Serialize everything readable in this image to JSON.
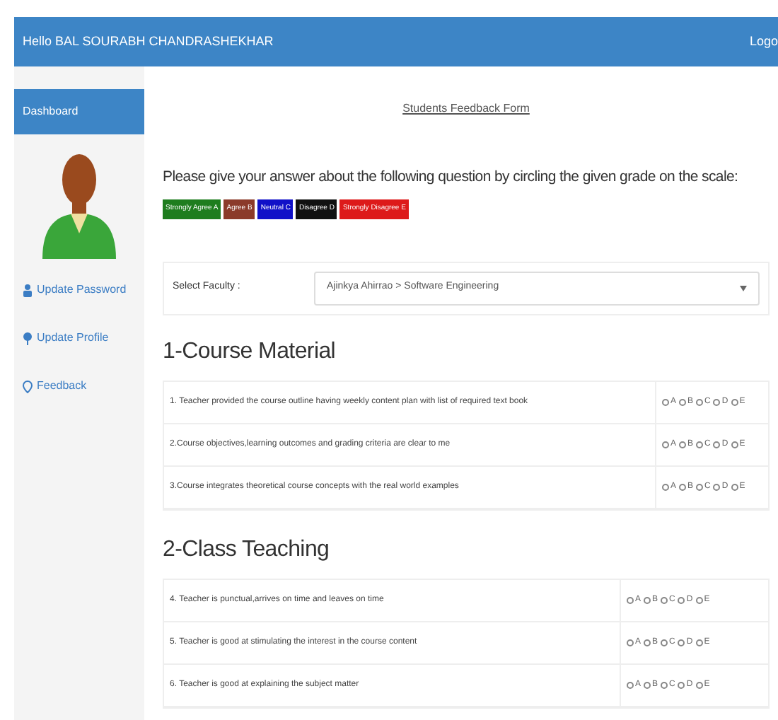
{
  "navbar": {
    "greeting": "Hello BAL SOURABH CHANDRASHEKHAR",
    "logout": "Logo"
  },
  "sidebar": {
    "header": "Dashboard",
    "items": [
      {
        "label": "Update Password",
        "kind": "user"
      },
      {
        "label": "Update Profile",
        "kind": "pin"
      },
      {
        "label": "Feedback",
        "kind": "marker"
      }
    ]
  },
  "form": {
    "title": "Students Feedback Form",
    "instruction": "Please give your answer about the following question by circling the given grade on the scale:",
    "legend": [
      {
        "label": "Strongly Agree A",
        "color": "#1e7d1e"
      },
      {
        "label": "Agree B",
        "color": "#8b3a2a"
      },
      {
        "label": "Neutral C",
        "color": "#1010c8"
      },
      {
        "label": "Disagree D",
        "color": "#111111"
      },
      {
        "label": "Strongly Disagree E",
        "color": "#dd1a1a"
      }
    ],
    "faculty_label": "Select Faculty :",
    "faculty_value": "Ajinkya Ahirrao > Software Engineering",
    "sections": [
      {
        "title": "1-Course Material",
        "questions": [
          {
            "text": "1. Teacher provided the course outline having weekly content plan with list of required text book",
            "options": [
              {
                "label": "A",
                "selected": false
              },
              {
                "label": "B",
                "selected": false
              },
              {
                "label": "C",
                "selected": false
              },
              {
                "label": "D",
                "selected": false
              },
              {
                "label": "E",
                "selected": false
              }
            ]
          },
          {
            "text": "2.Course objectives,learning outcomes and grading criteria are clear to me",
            "options": [
              {
                "label": "A",
                "selected": false
              },
              {
                "label": "B",
                "selected": false
              },
              {
                "label": "C",
                "selected": false
              },
              {
                "label": "D",
                "selected": false
              },
              {
                "label": "E",
                "selected": false
              }
            ]
          },
          {
            "text": "3.Course integrates theoretical course concepts with the real world examples",
            "options": [
              {
                "label": "A",
                "selected": false
              },
              {
                "label": "B",
                "selected": false
              },
              {
                "label": "C",
                "selected": false
              },
              {
                "label": "D",
                "selected": false
              },
              {
                "label": "E",
                "selected": false
              }
            ]
          }
        ]
      },
      {
        "title": "2-Class Teaching",
        "questions": [
          {
            "text": "4. Teacher is punctual,arrives on time and leaves on time",
            "options": [
              {
                "label": "A",
                "selected": false
              },
              {
                "label": "B",
                "selected": false
              },
              {
                "label": "C",
                "selected": false
              },
              {
                "label": "D",
                "selected": false
              },
              {
                "label": "E",
                "selected": false
              }
            ]
          },
          {
            "text": "5. Teacher is good at stimulating the interest in the course content",
            "options": [
              {
                "label": "A",
                "selected": false
              },
              {
                "label": "B",
                "selected": false
              },
              {
                "label": "C",
                "selected": false
              },
              {
                "label": "D",
                "selected": false
              },
              {
                "label": "E",
                "selected": false
              }
            ]
          },
          {
            "text": "6. Teacher is good at explaining the subject matter",
            "options": [
              {
                "label": "A",
                "selected": false
              },
              {
                "label": "B",
                "selected": false
              },
              {
                "label": "C",
                "selected": false
              },
              {
                "label": "D",
                "selected": false
              },
              {
                "label": "E",
                "selected": false
              }
            ]
          }
        ]
      }
    ]
  }
}
